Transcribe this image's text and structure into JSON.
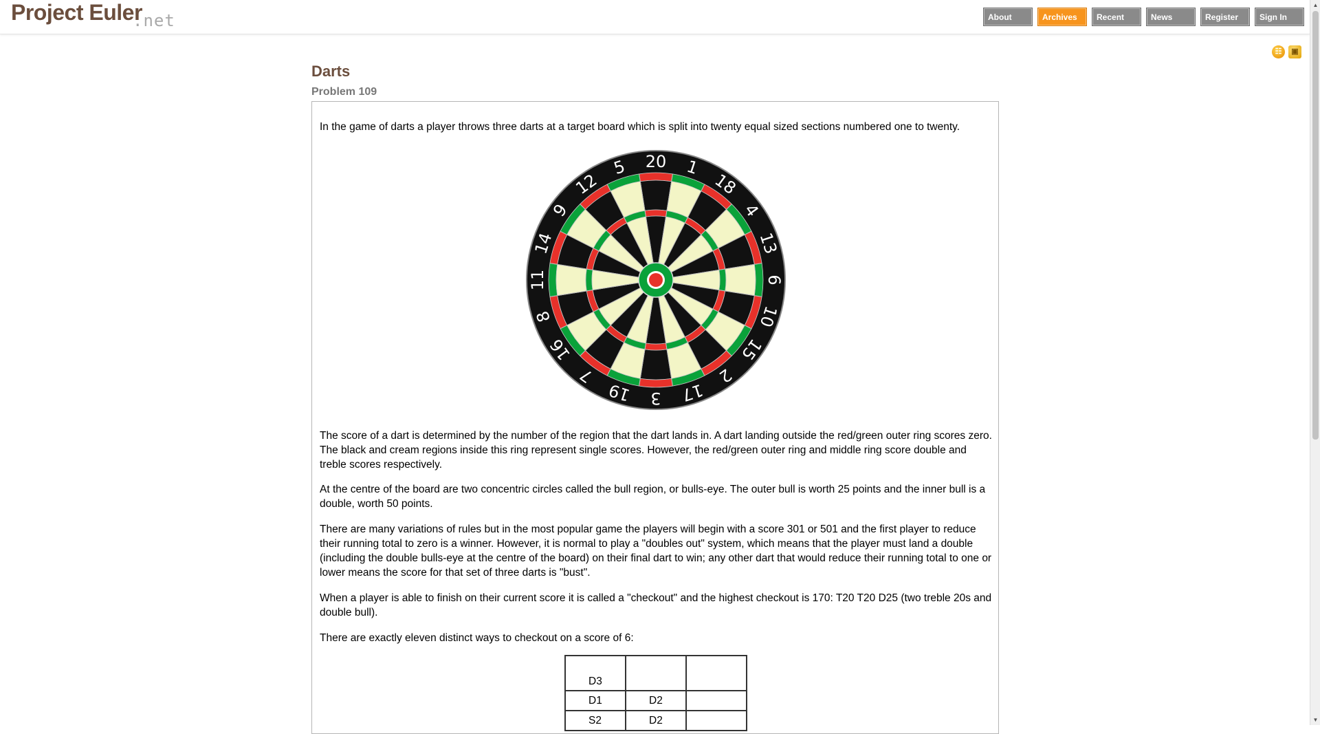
{
  "header": {
    "logo": "Project Euler",
    "logo_suffix": ".net",
    "nav": [
      {
        "label": "About"
      },
      {
        "label": "Archives"
      },
      {
        "label": "Recent"
      },
      {
        "label": "News"
      },
      {
        "label": "Register"
      },
      {
        "label": "Sign In"
      }
    ],
    "active_nav": "Archives"
  },
  "colors": {
    "brand_brown": "#6b4e3d",
    "nav_gray": "#8a8a8a",
    "nav_active": "#f7941d",
    "dart_red": "#e8312a",
    "dart_green": "#0aa23a",
    "dart_cream": "#f3f5c6"
  },
  "icons": [
    "rss-icon",
    "lock-icon"
  ],
  "problem": {
    "title": "Darts",
    "subtitle": "Problem 109",
    "paragraphs": [
      "In the game of darts a player throws three darts at a target board which is split into twenty equal sized sections numbered one to twenty.",
      "The score of a dart is determined by the number of the region that the dart lands in. A dart landing outside the red/green outer ring scores zero. The black and cream regions inside this ring represent single scores. However, the red/green outer ring and middle ring score double and treble scores respectively.",
      "At the centre of the board are two concentric circles called the bull region, or bulls-eye. The outer bull is worth 25 points and the inner bull is a double, worth 50 points.",
      "There are many variations of rules but in the most popular game the players will begin with a score 301 or 501 and the first player to reduce their running total to zero is a winner. However, it is normal to play a \"doubles out\" system, which means that the player must land a double (including the double bulls-eye at the centre of the board) on their final dart to win; any other dart that would reduce their running total to one or lower means the score for that set of three darts is \"bust\".",
      "When a player is able to finish on their current score it is called a \"checkout\" and the highest checkout is 170: T20 T20 D25 (two treble 20s and double bull).",
      "There are exactly eleven distinct ways to checkout on a score of 6:"
    ],
    "dartboard": {
      "numbers": [
        "20",
        "1",
        "18",
        "4",
        "13",
        "6",
        "10",
        "15",
        "2",
        "17",
        "3",
        "19",
        "7",
        "16",
        "8",
        "11",
        "14",
        "9",
        "12",
        "5"
      ]
    },
    "checkout_table": [
      [
        "D3",
        "",
        ""
      ],
      [
        "D1",
        "D2",
        ""
      ],
      [
        "S2",
        "D2",
        ""
      ]
    ]
  }
}
